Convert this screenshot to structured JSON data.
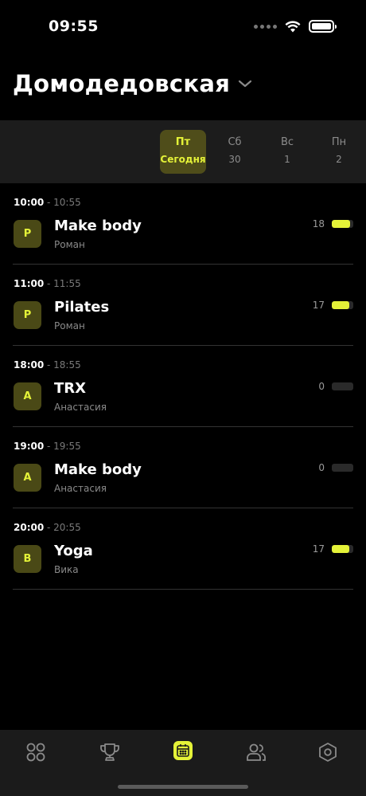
{
  "status_bar": {
    "time": "09:55"
  },
  "header": {
    "title": "Домодедовская"
  },
  "days": [
    {
      "name": "Пт",
      "number": "Сегодня",
      "active": true
    },
    {
      "name": "Сб",
      "number": "30",
      "active": false
    },
    {
      "name": "Вс",
      "number": "1",
      "active": false
    },
    {
      "name": "Пн",
      "number": "2",
      "active": false
    }
  ],
  "sessions": [
    {
      "start": "10:00",
      "end": " - 10:55",
      "initial": "Р",
      "name": "Make body",
      "trainer": "Роман",
      "count": "18",
      "fill_fraction": 0.85
    },
    {
      "start": "11:00",
      "end": " - 11:55",
      "initial": "Р",
      "name": "Pilates",
      "trainer": "Роман",
      "count": "17",
      "fill_fraction": 0.8
    },
    {
      "start": "18:00",
      "end": " - 18:55",
      "initial": "А",
      "name": "TRX",
      "trainer": "Анастасия",
      "count": "0",
      "fill_fraction": 0
    },
    {
      "start": "19:00",
      "end": " - 19:55",
      "initial": "А",
      "name": "Make body",
      "trainer": "Анастасия",
      "count": "0",
      "fill_fraction": 0
    },
    {
      "start": "20:00",
      "end": " - 20:55",
      "initial": "В",
      "name": "Yoga",
      "trainer": "Вика",
      "count": "17",
      "fill_fraction": 0.8
    }
  ],
  "tabs": [
    {
      "icon": "grid-circles-icon",
      "active": false
    },
    {
      "icon": "trophy-icon",
      "active": false
    },
    {
      "icon": "calendar-icon",
      "active": true
    },
    {
      "icon": "users-icon",
      "active": false
    },
    {
      "icon": "settings-hexagon-icon",
      "active": false
    }
  ],
  "colors": {
    "accent": "#e4f238",
    "accent_dark": "#4f4d1a",
    "background": "#000000"
  }
}
